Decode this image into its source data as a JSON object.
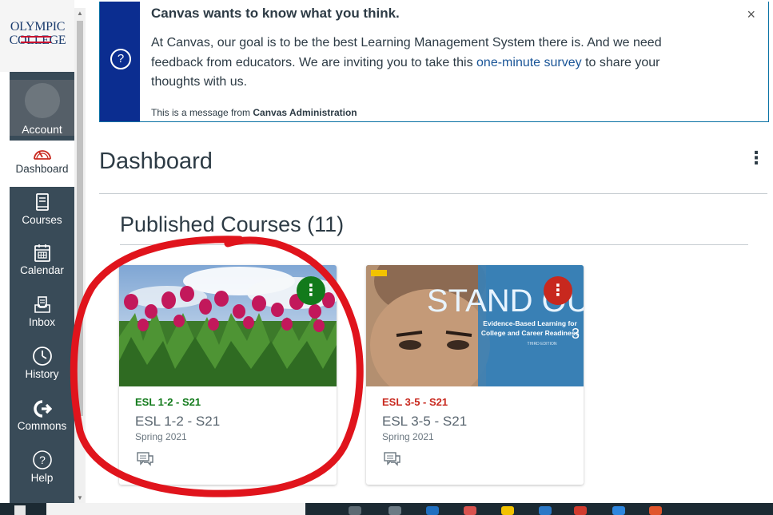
{
  "nav": {
    "logo_line1": "OLYMPIC",
    "logo_line2": "COLLEGE",
    "items": [
      {
        "label": "Account",
        "icon": "avatar"
      },
      {
        "label": "Dashboard",
        "icon": "dashboard-icon"
      },
      {
        "label": "Courses",
        "icon": "courses-icon"
      },
      {
        "label": "Calendar",
        "icon": "calendar-icon"
      },
      {
        "label": "Inbox",
        "icon": "inbox-icon"
      },
      {
        "label": "History",
        "icon": "history-icon"
      },
      {
        "label": "Commons",
        "icon": "commons-icon"
      },
      {
        "label": "Help",
        "icon": "help-icon"
      }
    ]
  },
  "alert": {
    "title": "Canvas wants to know what you think.",
    "body_before": "At Canvas, our goal is to be the best Learning Management System there is. And we need feedback from educators. We are inviting you to take this ",
    "link": "one-minute survey",
    "body_after": " to share your thoughts with us.",
    "from_prefix": "This is a message from ",
    "from_name": "Canvas Administration",
    "close": "×",
    "icon": "?"
  },
  "dashboard": {
    "title": "Dashboard",
    "options": "⋮",
    "section_title": "Published Courses (11)"
  },
  "courses": [
    {
      "code": "ESL 1-2 - S21",
      "name": "ESL 1-2 - S21",
      "term": "Spring 2021",
      "color": "#127a1b",
      "menu": "⋮"
    },
    {
      "code": "ESL 3-5 - S21",
      "name": "ESL 3-5 - S21",
      "term": "Spring 2021",
      "color": "#c8281e",
      "menu": "⋮",
      "image_title": "STAND OUT",
      "image_sub1": "Evidence-Based Learning for",
      "image_sub2": "College and Career Readiness",
      "image_num": "3",
      "image_edition": "THIRD EDITION"
    }
  ],
  "colors": {
    "nav": "#394b58",
    "alert_side": "#0b2d90",
    "annotation": "#e0141c"
  }
}
